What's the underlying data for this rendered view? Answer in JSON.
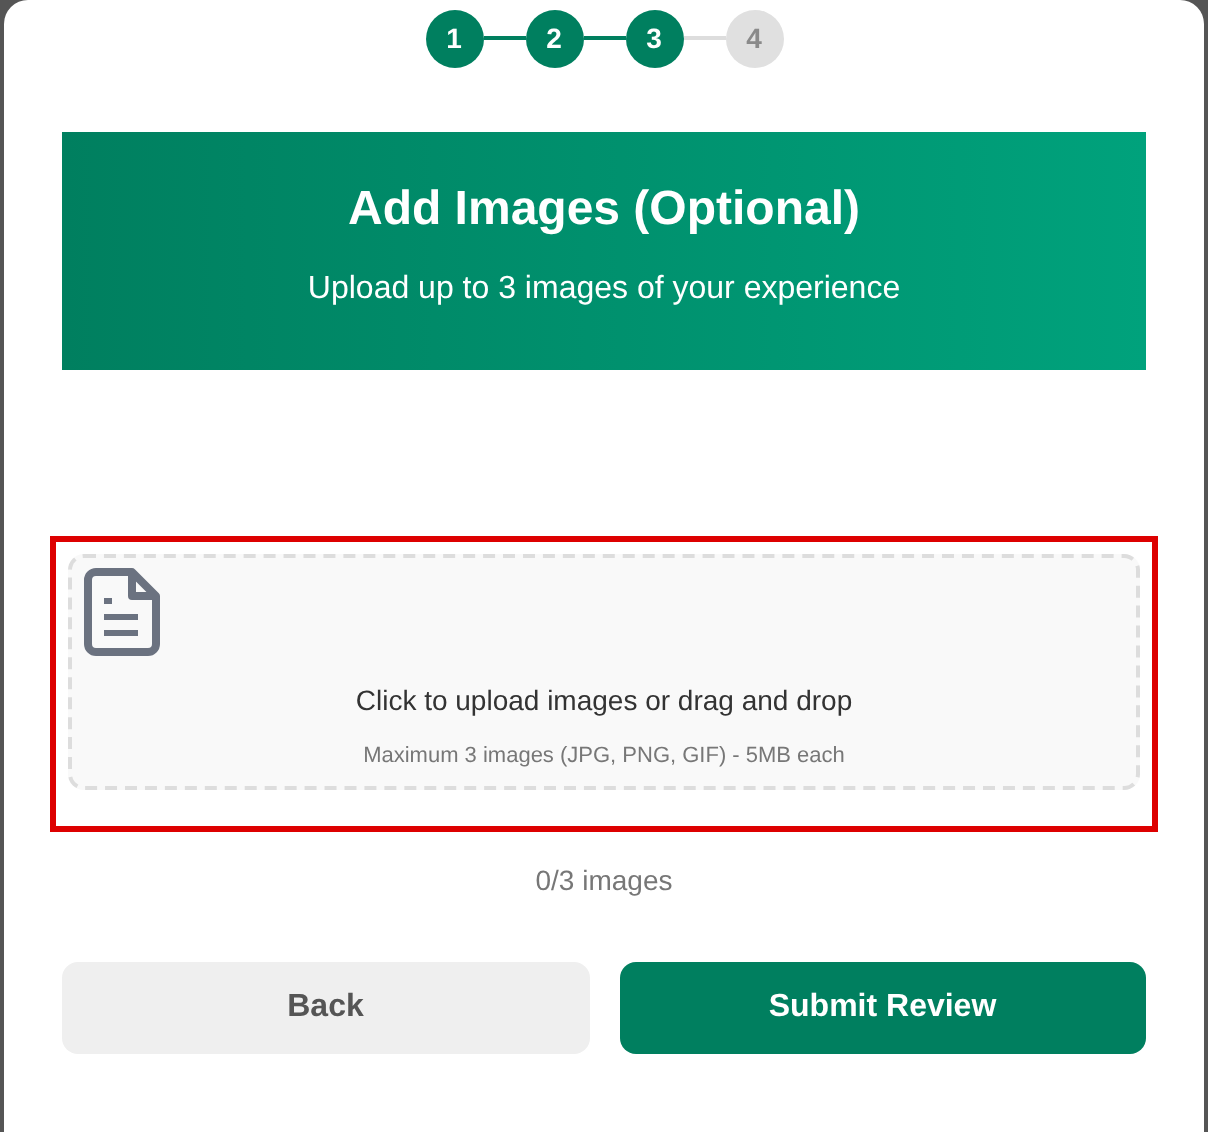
{
  "steps": [
    {
      "label": "1",
      "completed": true
    },
    {
      "label": "2",
      "completed": true
    },
    {
      "label": "3",
      "completed": true
    },
    {
      "label": "4",
      "completed": false
    }
  ],
  "header": {
    "title": "Add Images (Optional)",
    "subtitle": "Upload up to 3 images of your experience"
  },
  "dropzone": {
    "highlighted": true,
    "text": "Click to upload images or drag and drop",
    "hint": "Maximum 3 images (JPG, PNG, GIF) - 5MB each"
  },
  "count": "0/3 images",
  "buttons": [
    {
      "label": "Back",
      "kind": "secondary"
    },
    {
      "label": "Submit Review",
      "kind": "primary"
    }
  ]
}
